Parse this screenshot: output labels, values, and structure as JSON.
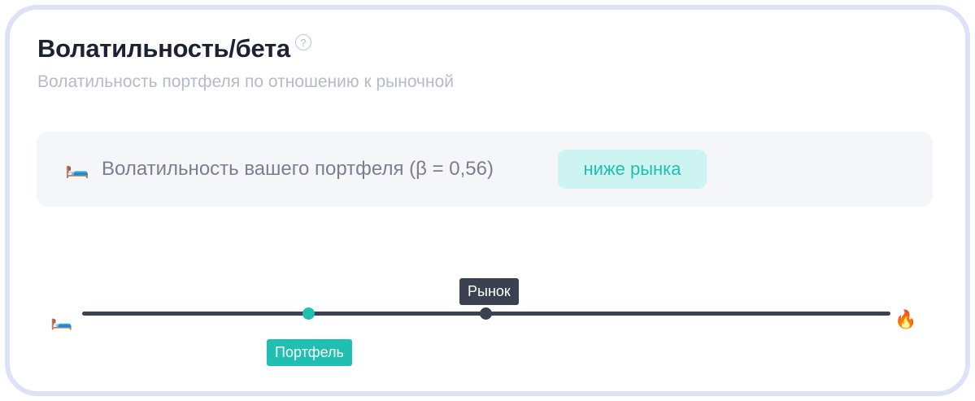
{
  "header": {
    "title": "Волатильность/бета",
    "help_icon": "?",
    "subtitle": "Волатильность портфеля по отношению к рыночной"
  },
  "info": {
    "emoji": "🛏️",
    "text": "Волатильность вашего портфеля (β = 0,56)",
    "badge": "ниже рынка"
  },
  "scale": {
    "left_emoji": "🛏️",
    "right_emoji": "🔥",
    "market_label": "Рынок",
    "portfolio_label": "Портфель"
  },
  "colors": {
    "accent": "#1fbfb2",
    "dark": "#3c4152",
    "border": "#dde2f6"
  }
}
